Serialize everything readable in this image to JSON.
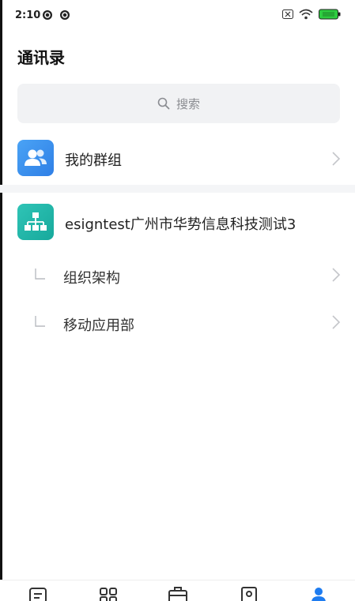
{
  "status_bar": {
    "time": "2:10",
    "icons": [
      "notification-icon",
      "notification-icon",
      "sim-icon",
      "wifi-icon",
      "battery-icon"
    ],
    "battery_color": "#2ecc40"
  },
  "header": {
    "title": "通讯录"
  },
  "search": {
    "placeholder": "搜索",
    "icon": "search-icon"
  },
  "groups": {
    "label": "我的群组",
    "icon": "group-icon",
    "icon_color": "#3a8ff0"
  },
  "organization": {
    "name": "esigntest广州市华势信息科技测试3",
    "icon": "org-chart-icon",
    "icon_color": "#1fb5a8",
    "departments": [
      {
        "label": "组织架构"
      },
      {
        "label": "移动应用部"
      }
    ]
  },
  "tab_bar": {
    "tabs": [
      {
        "icon": "message-icon"
      },
      {
        "icon": "apps-icon"
      },
      {
        "icon": "briefcase-icon"
      },
      {
        "icon": "contact-card-icon"
      },
      {
        "icon": "person-icon",
        "active": true
      }
    ],
    "accent": "#1e7cf0"
  }
}
